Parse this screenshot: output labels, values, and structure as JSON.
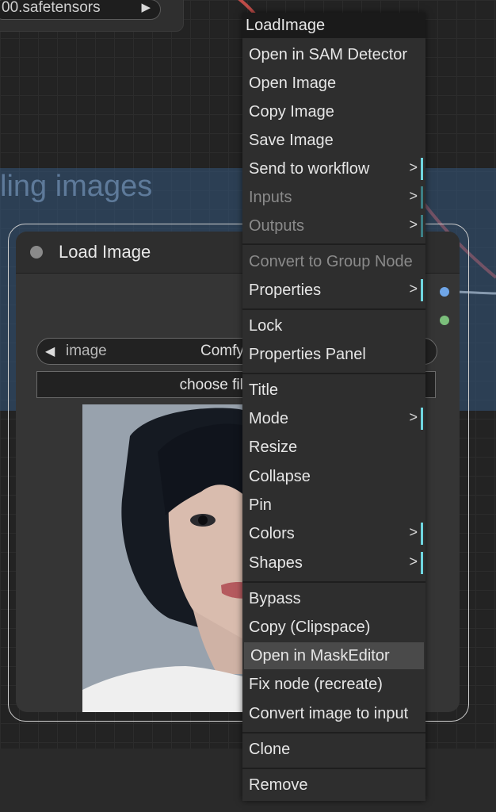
{
  "canvas": {
    "prev_node_text": "00.safetensors",
    "group_title": "ling images"
  },
  "node": {
    "title": "Load Image",
    "image_widget_label": "image",
    "image_widget_value": "Comfy",
    "choose_file_label": "choose file"
  },
  "context_menu": {
    "title": "LoadImage",
    "items": [
      {
        "label": "Open in SAM Detector"
      },
      {
        "label": "Open Image"
      },
      {
        "label": "Copy Image"
      },
      {
        "label": "Save Image"
      },
      {
        "label": "Send to workflow",
        "submenu": ">"
      },
      {
        "label": "Inputs",
        "submenu": ">"
      },
      {
        "label": "Outputs",
        "submenu": ">"
      },
      {
        "label": "Convert to Group Node"
      },
      {
        "label": "Properties",
        "submenu": ">"
      },
      {
        "label": "Lock"
      },
      {
        "label": "Properties Panel"
      },
      {
        "label": "Title"
      },
      {
        "label": "Mode",
        "submenu": ">"
      },
      {
        "label": "Resize"
      },
      {
        "label": "Collapse"
      },
      {
        "label": "Pin"
      },
      {
        "label": "Colors",
        "submenu": ">"
      },
      {
        "label": "Shapes",
        "submenu": ">"
      },
      {
        "label": "Bypass"
      },
      {
        "label": "Copy (Clipspace)"
      },
      {
        "label": "Open in MaskEditor"
      },
      {
        "label": "Fix node (recreate)"
      },
      {
        "label": "Convert image to input"
      },
      {
        "label": "Clone"
      },
      {
        "label": "Remove"
      }
    ]
  },
  "colors": {
    "submenu_indicator": "#6fd6e0",
    "port_image": "#6fa6e8",
    "port_mask": "#7bbf7b",
    "wire": "#d9534f"
  }
}
